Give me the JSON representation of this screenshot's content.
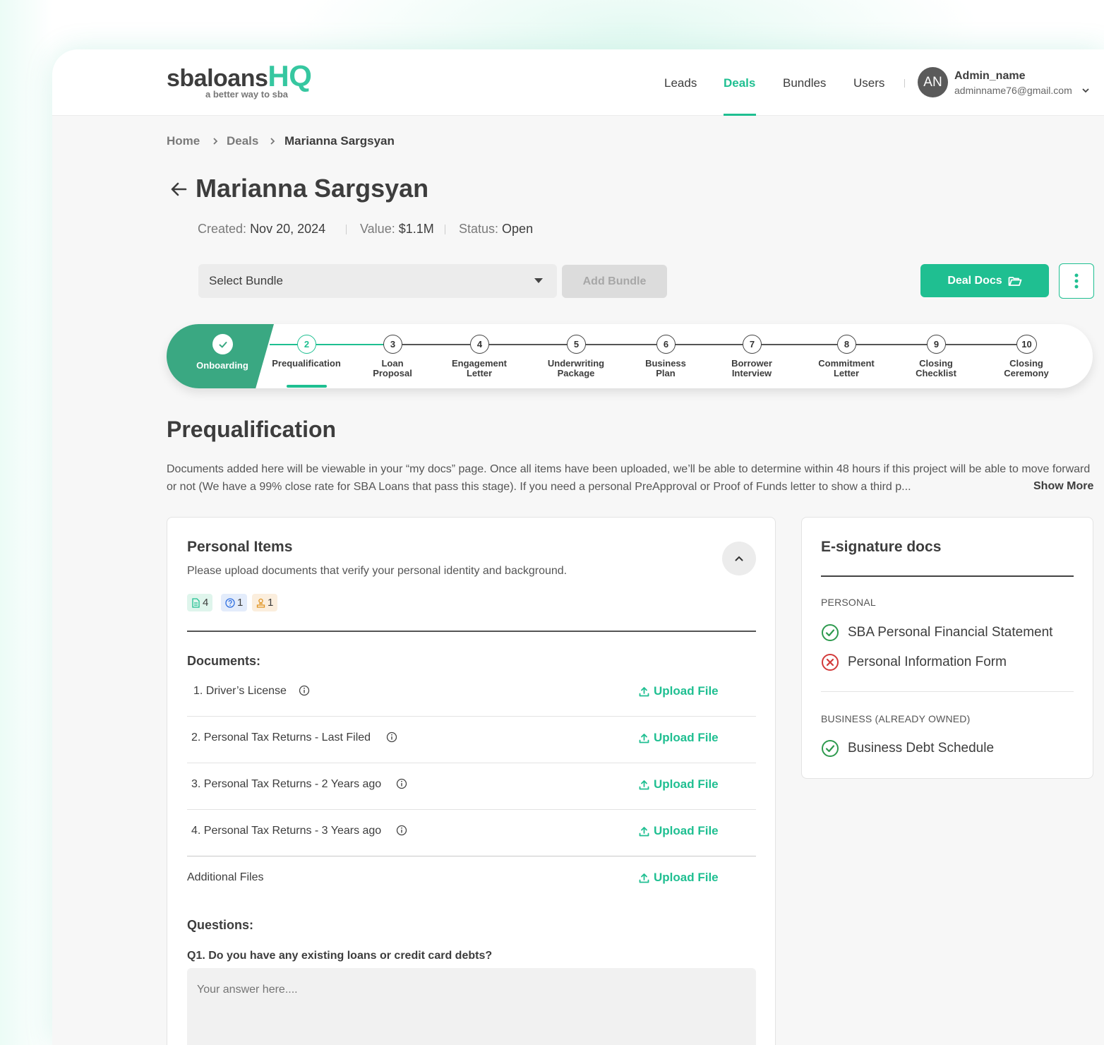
{
  "brand": {
    "name_main": "sbaloans",
    "name_accent": "HQ",
    "tagline": "a better way to sba",
    "accent_color": "#1fbf91"
  },
  "nav": {
    "items": [
      {
        "label": "Leads"
      },
      {
        "label": "Deals",
        "active": true
      },
      {
        "label": "Bundles"
      },
      {
        "label": "Users"
      }
    ],
    "user": {
      "initials": "AN",
      "name": "Admin_name",
      "email": "adminname76@gmail.com"
    }
  },
  "breadcrumb": [
    "Home",
    "Deals",
    "Marianna Sargsyan"
  ],
  "deal": {
    "title": "Marianna Sargsyan",
    "created_label": "Created:",
    "created_value": "Nov 20, 2024",
    "value_label": "Value:",
    "value_value": "$1.1M",
    "status_label": "Status:",
    "status_value": "Open"
  },
  "toolbar": {
    "select_bundle": "Select Bundle",
    "add_bundle": "Add Bundle",
    "deal_docs": "Deal Docs"
  },
  "stepper": {
    "completed": {
      "label": "Onboarding"
    },
    "steps": [
      {
        "num": "2",
        "line1": "Prequalification",
        "line2": "",
        "active": true
      },
      {
        "num": "3",
        "line1": "Loan",
        "line2": "Proposal"
      },
      {
        "num": "4",
        "line1": "Engagement",
        "line2": "Letter"
      },
      {
        "num": "5",
        "line1": "Underwriting",
        "line2": "Package"
      },
      {
        "num": "6",
        "line1": "Business",
        "line2": "Plan"
      },
      {
        "num": "7",
        "line1": "Borrower",
        "line2": "Interview"
      },
      {
        "num": "8",
        "line1": "Commitment",
        "line2": "Letter"
      },
      {
        "num": "9",
        "line1": "Closing",
        "line2": "Checklist"
      },
      {
        "num": "10",
        "line1": "Closing",
        "line2": "Ceremony"
      }
    ]
  },
  "section": {
    "title": "Prequalification",
    "description": "Documents added here will be viewable in your “my docs” page. Once all items have been uploaded, we’ll be able to determine within 48 hours if this project will be able to move forward or not (We have a 99% close rate for SBA Loans that pass this stage). If you need a personal PreApproval or Proof of Funds letter to show a third p...",
    "show_more": "Show More"
  },
  "personal_items": {
    "title": "Personal Items",
    "subtitle": "Please upload documents that verify your personal identity and background.",
    "badges": {
      "documents": "4",
      "questions": "1",
      "users": "1"
    },
    "documents_heading": "Documents:",
    "documents": [
      {
        "label": "1. Driver’s License",
        "action": "Upload File"
      },
      {
        "label": "2. Personal Tax Returns - Last Filed",
        "action": "Upload File"
      },
      {
        "label": "3. Personal Tax Returns - 2 Years ago",
        "action": "Upload File"
      },
      {
        "label": "4. Personal Tax Returns - 3 Years ago",
        "action": "Upload File"
      }
    ],
    "additional": {
      "label": "Additional Files",
      "action": "Upload File"
    },
    "questions_heading": "Questions:",
    "question": "Q1. Do you have any existing loans or credit card debts?",
    "answer_placeholder": "Your answer here...."
  },
  "esignature": {
    "title": "E-signature docs",
    "groups": [
      {
        "name": "PERSONAL",
        "items": [
          {
            "label": "SBA Personal Financial Statement",
            "status": "complete"
          },
          {
            "label": "Personal Information Form",
            "status": "missing"
          }
        ]
      },
      {
        "name": "BUSINESS (ALREADY OWNED)",
        "items": [
          {
            "label": "Business Debt Schedule",
            "status": "complete"
          }
        ]
      }
    ]
  }
}
